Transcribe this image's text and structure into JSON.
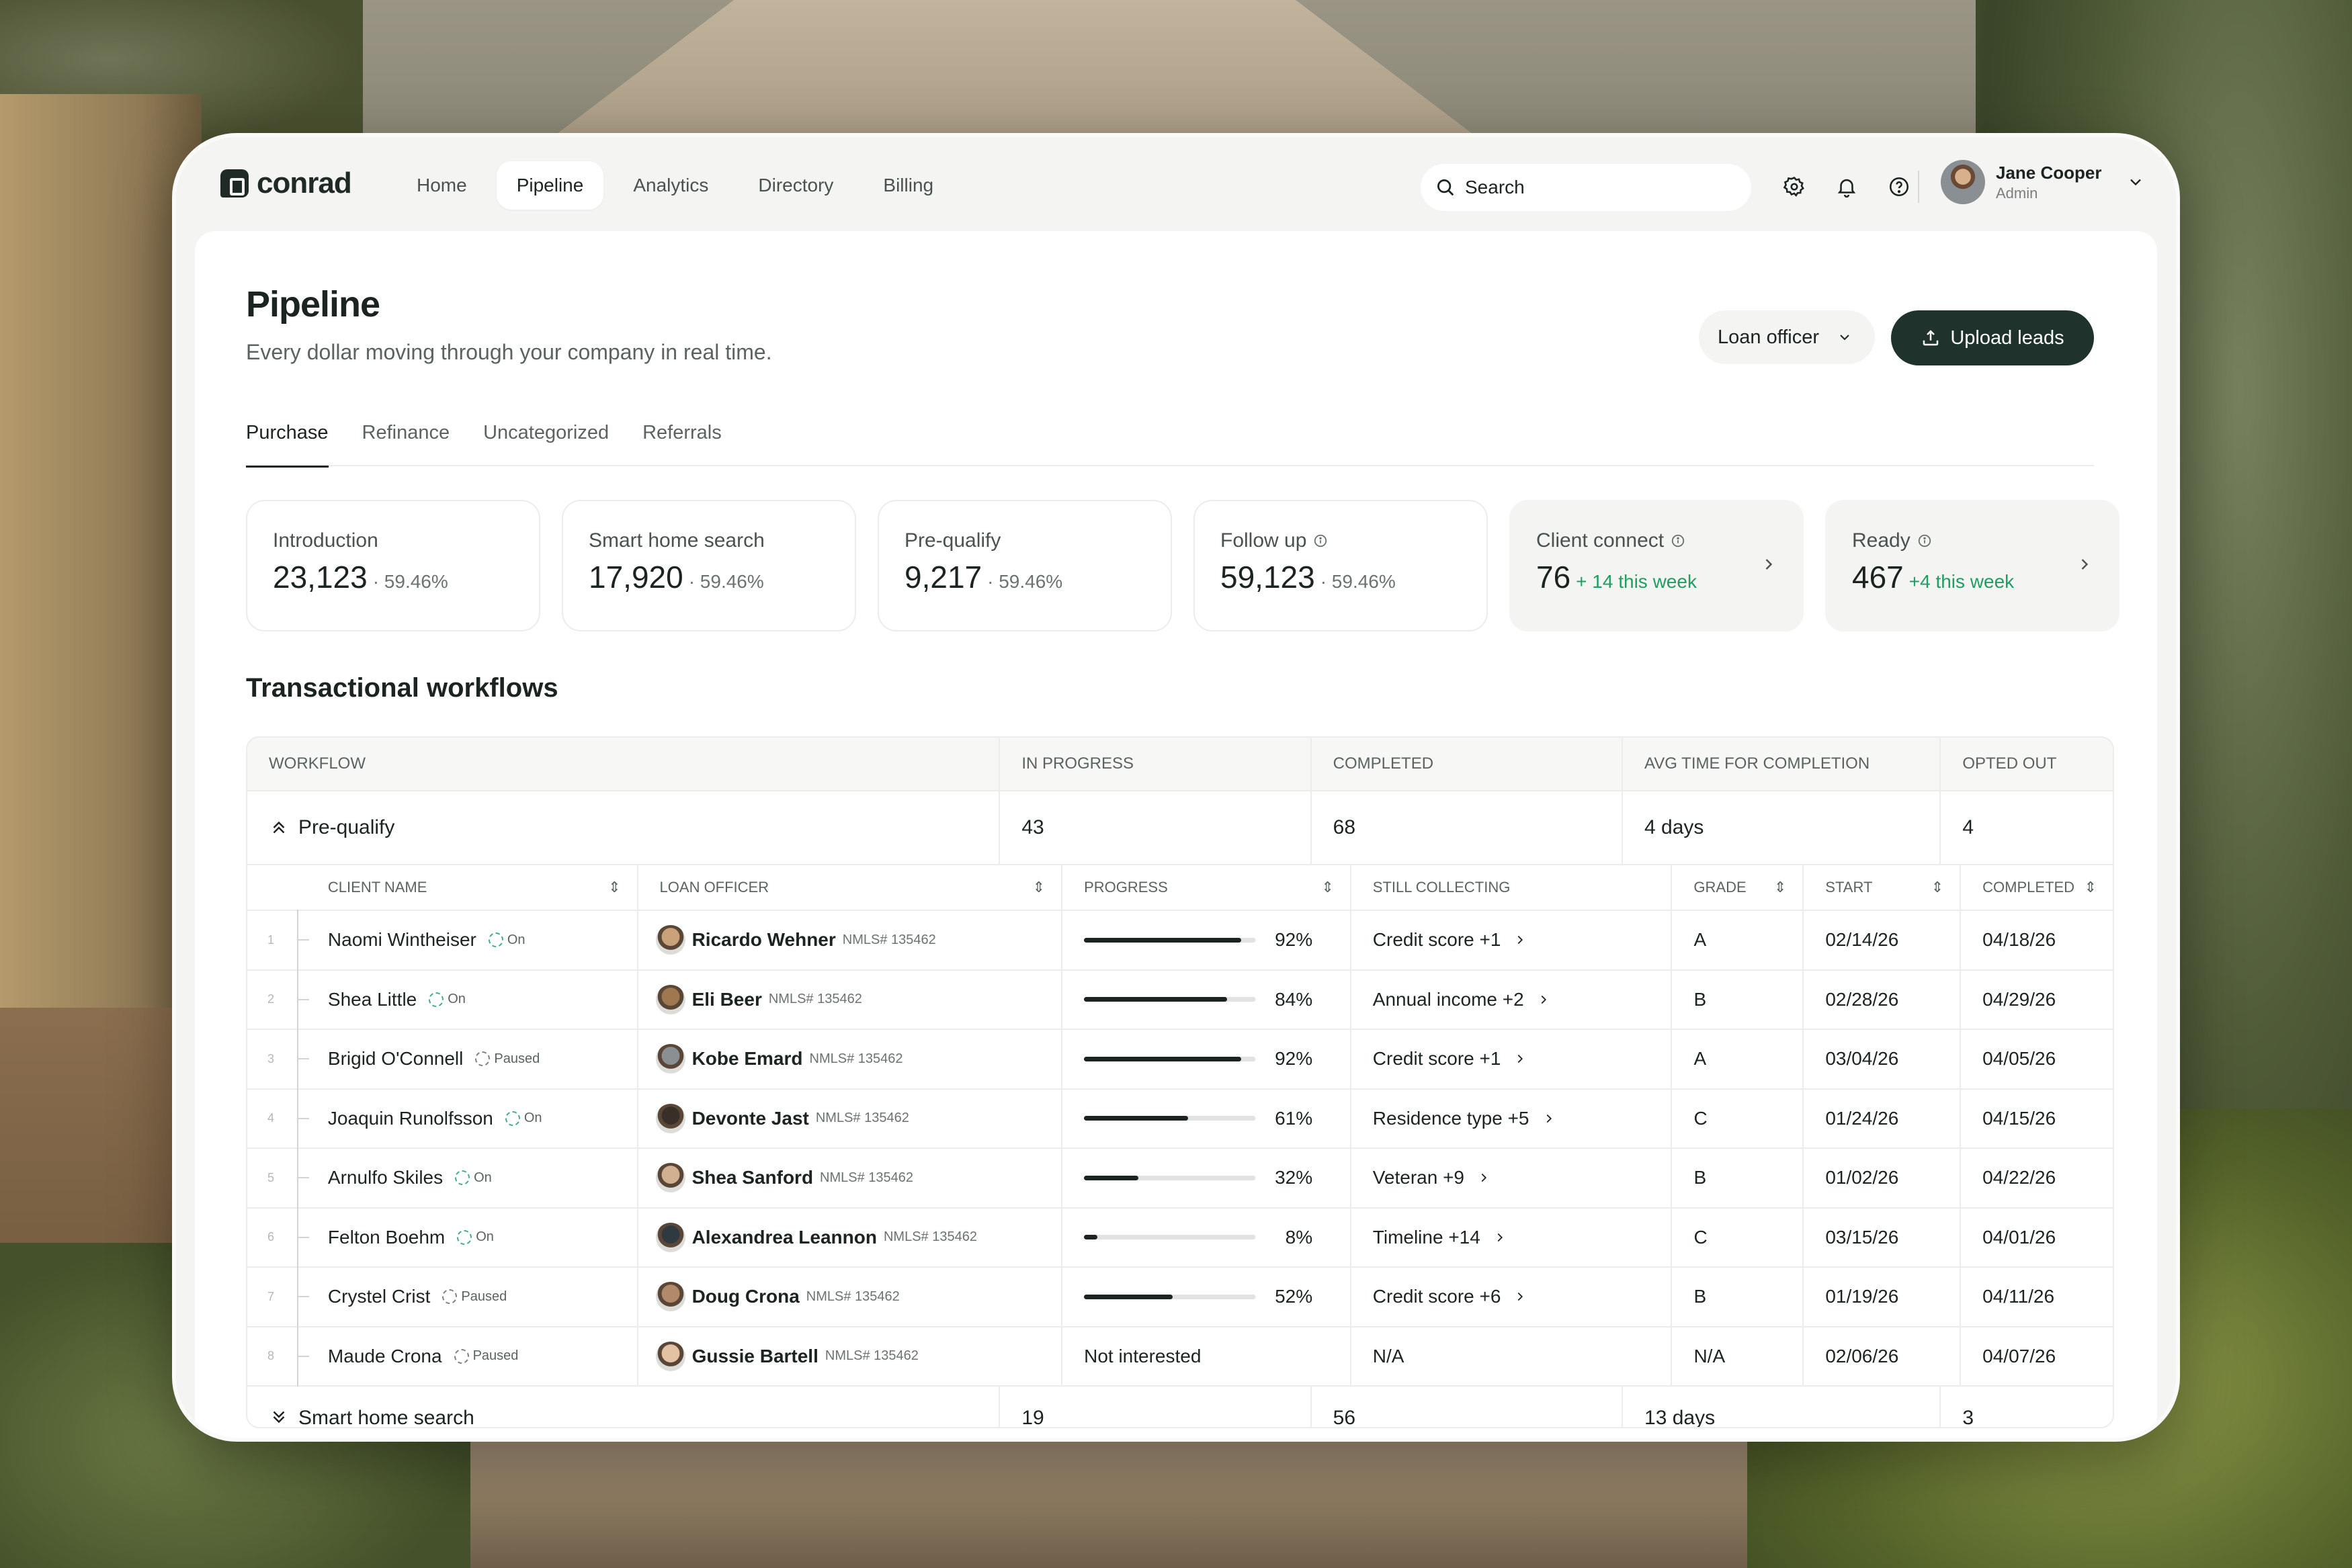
{
  "brand": {
    "name": "conrad"
  },
  "nav": {
    "items": [
      "Home",
      "Pipeline",
      "Analytics",
      "Directory",
      "Billing"
    ],
    "active": "Pipeline"
  },
  "search": {
    "placeholder": "Search"
  },
  "user": {
    "name": "Jane Cooper",
    "role": "Admin"
  },
  "header": {
    "title": "Pipeline",
    "subtitle": "Every dollar moving through your company in real time."
  },
  "filter": {
    "label": "Loan officer"
  },
  "upload": {
    "label": "Upload leads"
  },
  "tabs": [
    "Purchase",
    "Refinance",
    "Uncategorized",
    "Referrals"
  ],
  "active_tab": "Purchase",
  "cards": [
    {
      "label": "Introduction",
      "value": "23,123",
      "pct": "· 59.46%"
    },
    {
      "label": "Smart home search",
      "value": "17,920",
      "pct": "· 59.46%"
    },
    {
      "label": "Pre-qualify",
      "value": "9,217",
      "pct": "· 59.46%"
    },
    {
      "label": "Follow up",
      "value": "59,123",
      "pct": "· 59.46%"
    },
    {
      "label": "Client connect",
      "value": "76",
      "delta": "+ 14 this week"
    },
    {
      "label": "Ready",
      "value": "467",
      "delta": "+4 this week"
    }
  ],
  "workflows": {
    "title": "Transactional workflows",
    "headers": [
      "Workflow",
      "In progress",
      "Completed",
      "Avg time for completion",
      "Opted out"
    ],
    "group": {
      "name": "Pre-qualify",
      "in_progress": "43",
      "completed": "68",
      "avg_time": "4 days",
      "opted_out": "4"
    },
    "sub_headers": [
      "Client name",
      "Loan officer",
      "Progress",
      "Still collecting",
      "Grade",
      "Start",
      "Completed"
    ],
    "rows": [
      {
        "num": "1",
        "client": "Naomi Wintheiser",
        "status": "On",
        "officer": "Ricardo Wehner",
        "nmls": "NMLS# 135462",
        "progress": 0.92,
        "progress_label": "92%",
        "collecting": "Credit score +1",
        "grade": "A",
        "start": "02/14/26",
        "completed": "04/18/26"
      },
      {
        "num": "2",
        "client": "Shea Little",
        "status": "On",
        "officer": "Eli Beer",
        "nmls": "NMLS# 135462",
        "progress": 0.84,
        "progress_label": "84%",
        "collecting": "Annual income +2",
        "grade": "B",
        "start": "02/28/26",
        "completed": "04/29/26"
      },
      {
        "num": "3",
        "client": "Brigid O'Connell",
        "status": "Paused",
        "officer": "Kobe Emard",
        "nmls": "NMLS# 135462",
        "progress": 0.92,
        "progress_label": "92%",
        "collecting": "Credit score +1",
        "grade": "A",
        "start": "03/04/26",
        "completed": "04/05/26"
      },
      {
        "num": "4",
        "client": "Joaquin Runolfsson",
        "status": "On",
        "officer": "Devonte Jast",
        "nmls": "NMLS# 135462",
        "progress": 0.61,
        "progress_label": "61%",
        "collecting": "Residence type +5",
        "grade": "C",
        "start": "01/24/26",
        "completed": "04/15/26"
      },
      {
        "num": "5",
        "client": "Arnulfo Skiles",
        "status": "On",
        "officer": "Shea Sanford",
        "nmls": "NMLS# 135462",
        "progress": 0.32,
        "progress_label": "32%",
        "collecting": "Veteran +9",
        "grade": "B",
        "start": "01/02/26",
        "completed": "04/22/26"
      },
      {
        "num": "6",
        "client": "Felton Boehm",
        "status": "On",
        "officer": "Alexandrea Leannon",
        "nmls": "NMLS# 135462",
        "progress": 0.08,
        "progress_label": "8%",
        "collecting": "Timeline +14",
        "grade": "C",
        "start": "03/15/26",
        "completed": "04/01/26"
      },
      {
        "num": "7",
        "client": "Crystel Crist",
        "status": "Paused",
        "officer": "Doug Crona",
        "nmls": "NMLS# 135462",
        "progress": 0.52,
        "progress_label": "52%",
        "collecting": "Credit score +6",
        "grade": "B",
        "start": "01/19/26",
        "completed": "04/11/26"
      },
      {
        "num": "8",
        "client": "Maude Crona",
        "status": "Paused",
        "officer": "Gussie Bartell",
        "nmls": "NMLS# 135462",
        "progress": null,
        "progress_label": "Not interested",
        "collecting": "N/A",
        "grade": "N/A",
        "start": "02/06/26",
        "completed": "04/07/26"
      }
    ],
    "next_group": {
      "name": "Smart home search",
      "in_progress": "19",
      "completed": "56",
      "avg_time": "13 days",
      "opted_out": "3"
    }
  },
  "colors": {
    "accent": "#1f332c",
    "positive": "#1f9d62",
    "status_on": "#3fae7a"
  }
}
